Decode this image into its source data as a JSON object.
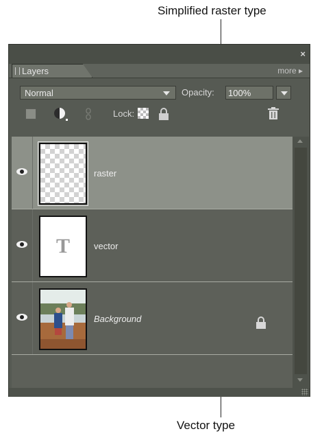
{
  "callouts": {
    "top": "Simplified raster type",
    "bottom": "Vector type"
  },
  "panel": {
    "close": "×",
    "tab_label": "Layers",
    "more_label": "more ▸",
    "blend_mode": "Normal",
    "opacity_label": "Opacity:",
    "opacity_value": "100%",
    "lock_label": "Lock:"
  },
  "layers": [
    {
      "name": "raster",
      "visible": true,
      "selected": true,
      "thumbnail": "transparent-checker"
    },
    {
      "name": "vector",
      "visible": true,
      "selected": false,
      "thumbnail": "type-T",
      "thumb_glyph": "T"
    },
    {
      "name": "Background",
      "visible": true,
      "selected": false,
      "thumbnail": "photo",
      "locked": true
    }
  ],
  "colors": {
    "panel_bg": "#565a53",
    "selected_row": "#8d9189",
    "row_divider": "#a9aca4"
  },
  "icons": [
    "close-icon",
    "new-layer-icon",
    "adjustment-layer-icon",
    "link-icon",
    "lock-transparency-icon",
    "lock-all-icon",
    "trash-icon",
    "eye-icon",
    "lock-icon",
    "resize-grip-icon"
  ]
}
